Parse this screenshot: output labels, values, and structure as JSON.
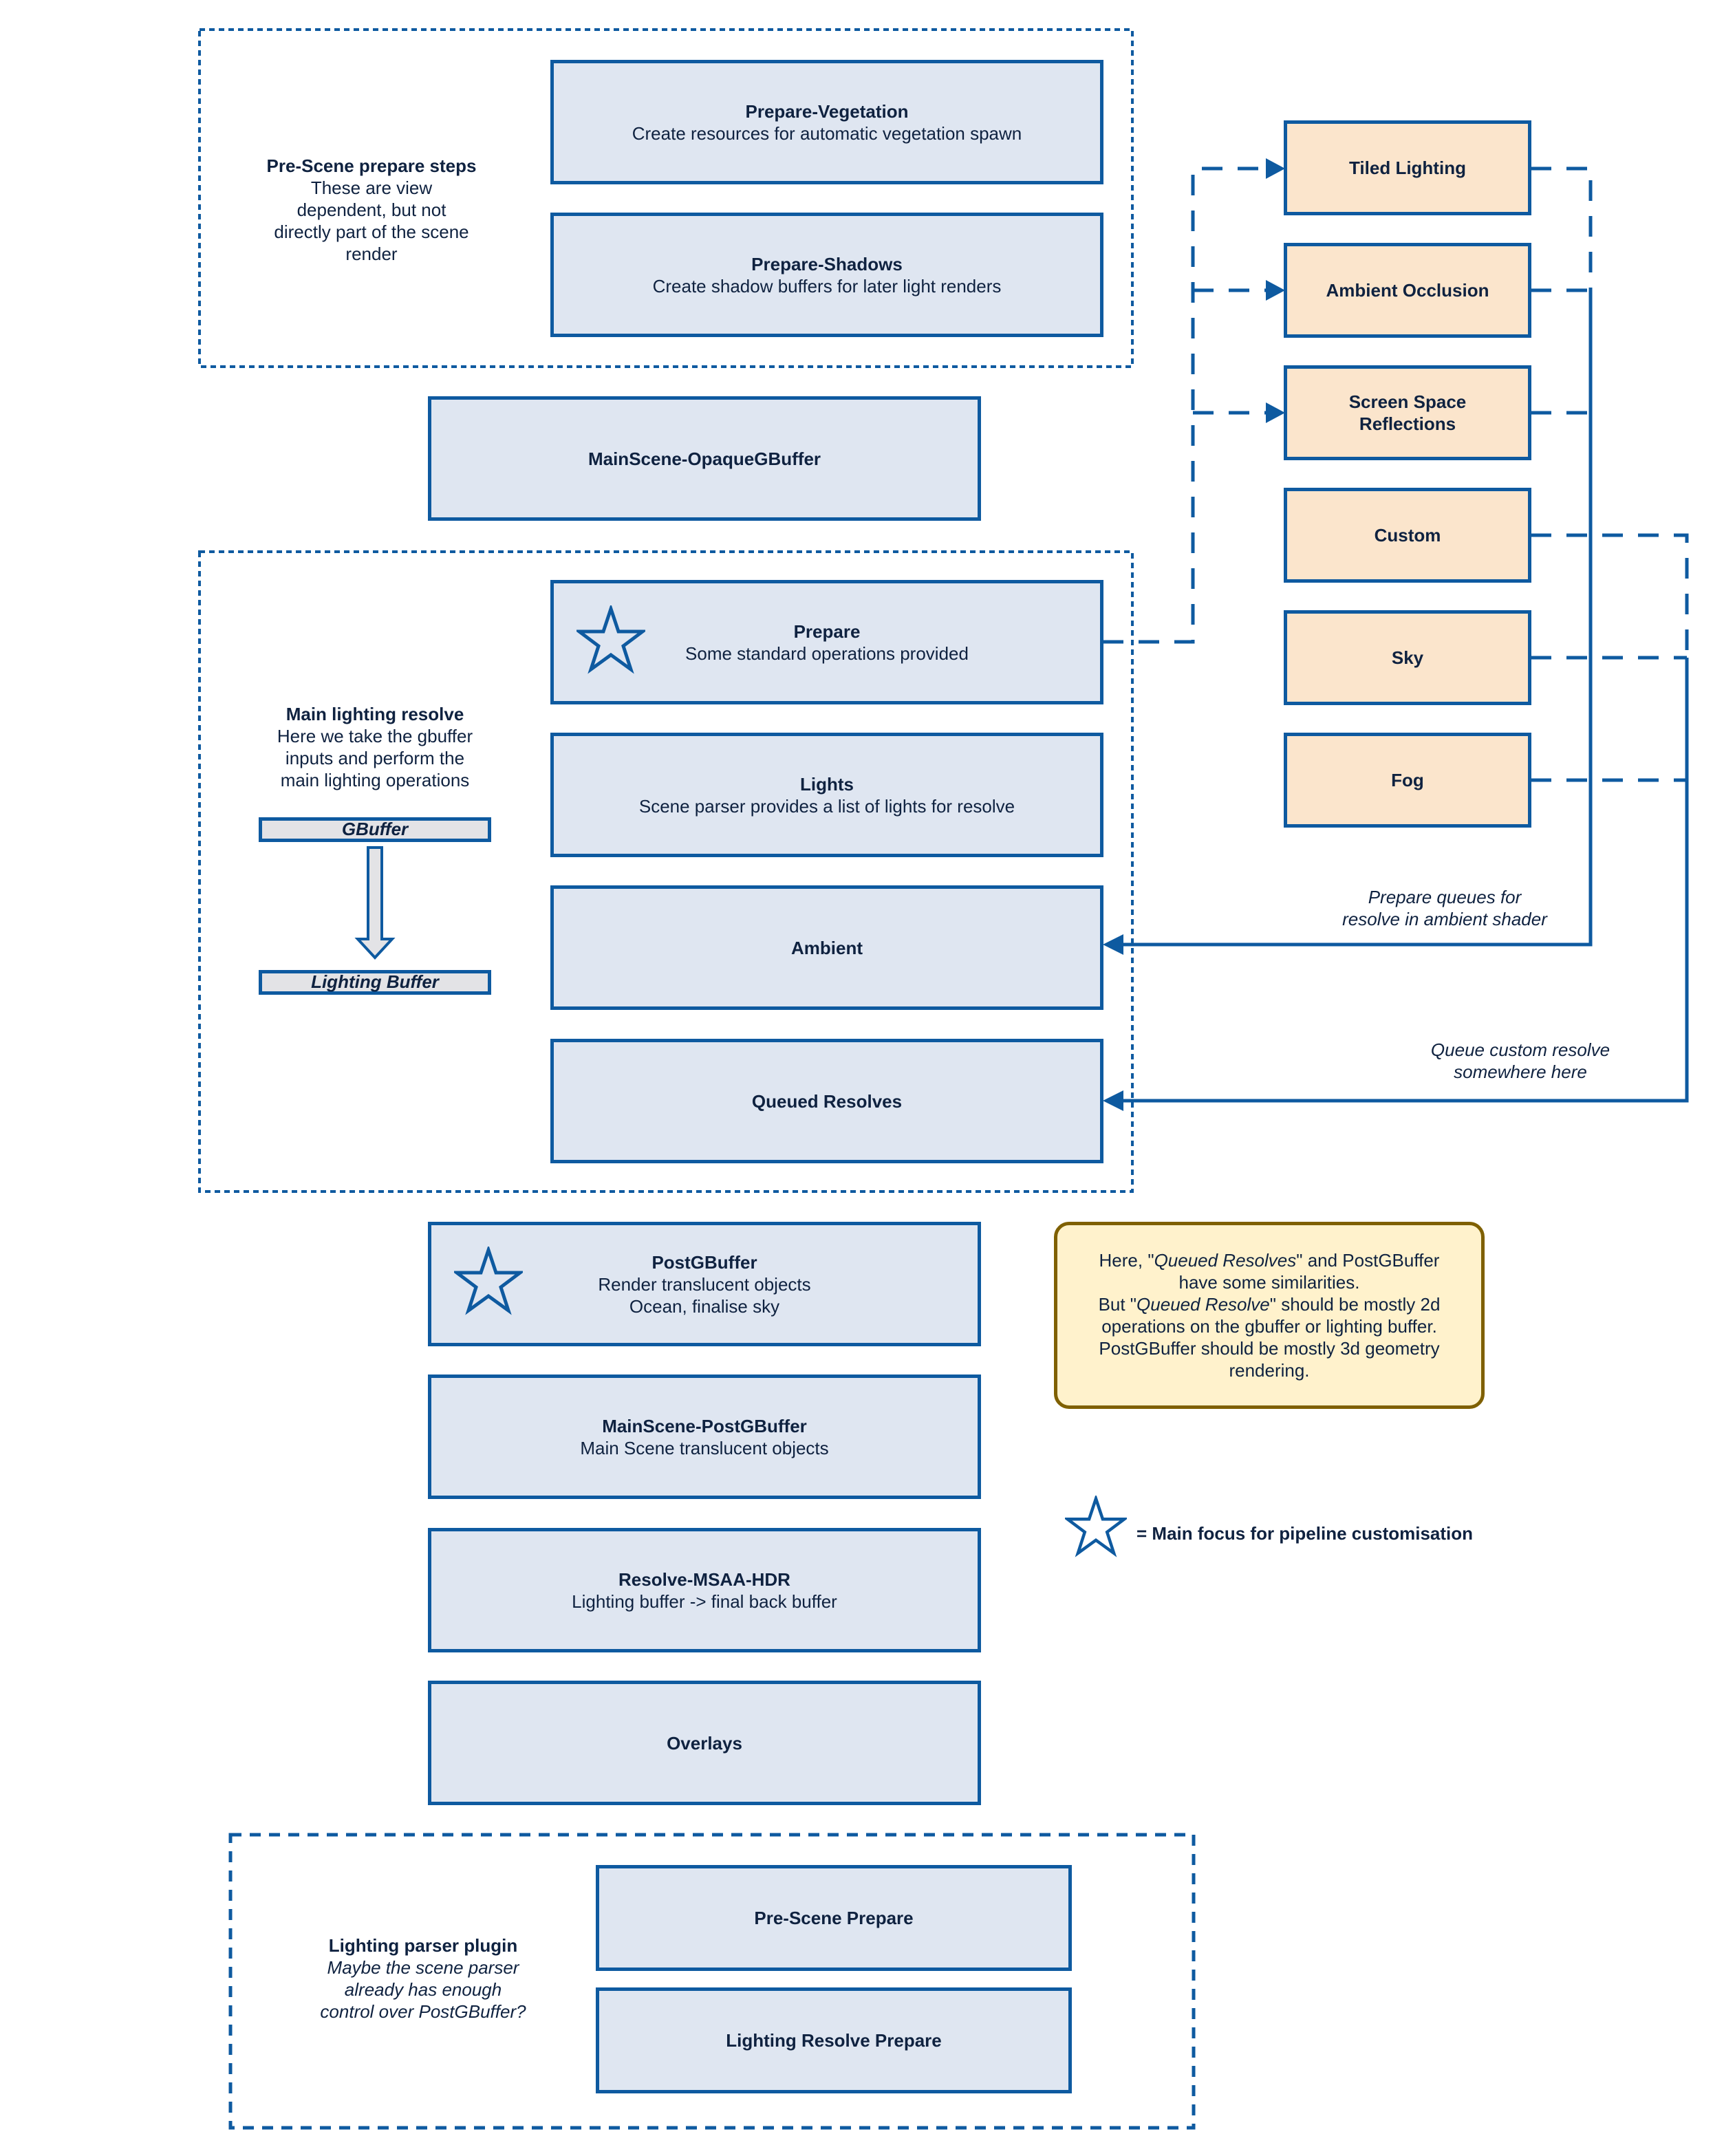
{
  "colors": {
    "stroke": "#0e5aa0",
    "blue_fill": "#dfe6f1",
    "orange_fill": "#fbe5cc",
    "note_fill": "#fff2cc",
    "note_stroke": "#7f6000",
    "text": "#0f2240"
  },
  "groups": {
    "pre_scene": {
      "title": "Pre-Scene prepare steps",
      "lines": [
        "These are view",
        "dependent, but not",
        "directly part of the scene",
        "render"
      ]
    },
    "main_lighting": {
      "title": "Main lighting resolve",
      "lines": [
        "Here we take the gbuffer",
        "inputs and perform the",
        "main lighting operations"
      ],
      "buffer_in": "GBuffer",
      "buffer_out": "Lighting Buffer"
    },
    "parser_plugin": {
      "title": "Lighting parser plugin",
      "lines": [
        "Maybe the scene parser",
        "already has enough",
        "control over PostGBuffer?"
      ]
    }
  },
  "steps": {
    "prepare_vegetation": {
      "title": "Prepare-Vegetation",
      "subtitle": "Create resources for automatic vegetation spawn"
    },
    "prepare_shadows": {
      "title": "Prepare-Shadows",
      "subtitle": "Create shadow buffers for later light renders"
    },
    "opaque_gbuffer": {
      "title": "MainScene-OpaqueGBuffer"
    },
    "prepare": {
      "title": "Prepare",
      "subtitle": "Some standard operations provided"
    },
    "lights": {
      "title": "Lights",
      "subtitle": "Scene parser provides a list of lights for resolve"
    },
    "ambient": {
      "title": "Ambient"
    },
    "queued_resolves": {
      "title": "Queued Resolves"
    },
    "post_gbuffer": {
      "title": "PostGBuffer",
      "subtitle": "Render translucent objects",
      "subtitle2": "Ocean, finalise sky"
    },
    "mainscene_post_gbuffer": {
      "title": "MainScene-PostGBuffer",
      "subtitle": "Main Scene translucent objects"
    },
    "resolve_msaa_hdr": {
      "title": "Resolve-MSAA-HDR",
      "subtitle": "Lighting buffer -> final back buffer"
    },
    "overlays": {
      "title": "Overlays"
    },
    "pre_scene_prepare": {
      "title": "Pre-Scene Prepare"
    },
    "lighting_resolve_prepare": {
      "title": "Lighting Resolve Prepare"
    }
  },
  "effects": [
    {
      "title": "Tiled Lighting"
    },
    {
      "title": "Ambient Occlusion"
    },
    {
      "title": "Screen Space",
      "title2": "Reflections"
    },
    {
      "title": "Custom"
    },
    {
      "title": "Sky"
    },
    {
      "title": "Fog"
    }
  ],
  "edge_labels": {
    "ambient_queue": [
      "Prepare queues for",
      "resolve in ambient shader"
    ],
    "custom_queue": [
      "Queue custom resolve",
      "somewhere here"
    ]
  },
  "note": {
    "line1_a": "Here, \"",
    "line1_i": "Queued Resolves",
    "line1_b": "\" and PostGBuffer",
    "line2": "have some similarities.",
    "line3_a": "But \"",
    "line3_i": "Queued Resolve",
    "line3_b": "\" should be mostly 2d",
    "line4": "operations on the gbuffer or lighting buffer.",
    "line5": "PostGBuffer should be mostly 3d geometry",
    "line6": "rendering."
  },
  "legend": {
    "icon": "star-icon",
    "text": "= Main focus for pipeline customisation"
  }
}
